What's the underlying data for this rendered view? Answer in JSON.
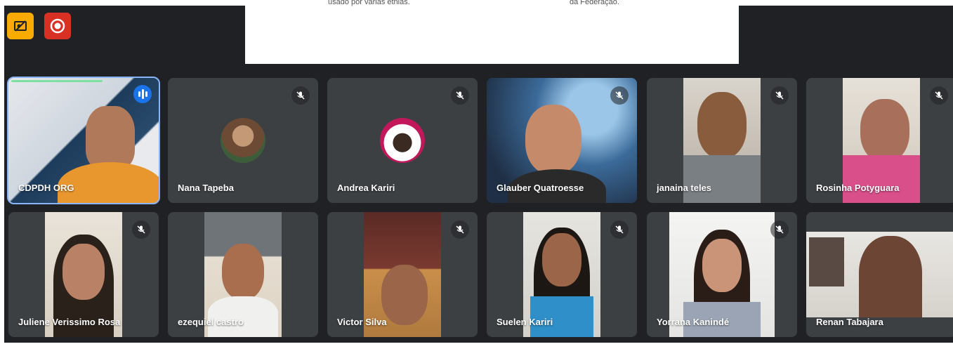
{
  "shared_screen": {
    "text_left": "usado por várias etnias.",
    "text_right": "da Federação."
  },
  "toolbar": {
    "hide_icon": "hide-self-view-icon",
    "record_icon": "recording-icon"
  },
  "colors": {
    "background": "#202124",
    "tile": "#3c4043",
    "active_outline": "#8ab4f8",
    "hide_button": "#f9ab00",
    "record_button": "#d93025",
    "speaking": "#1a73e8"
  },
  "participants": [
    {
      "name": "CDPDH ORG",
      "state": "speaking",
      "view": "camera"
    },
    {
      "name": "Nana Tapeba",
      "state": "muted",
      "view": "avatar"
    },
    {
      "name": "Andrea Kariri",
      "state": "muted",
      "view": "avatar"
    },
    {
      "name": "Glauber Quatroesse",
      "state": "muted",
      "view": "camera"
    },
    {
      "name": "janaina teles",
      "state": "muted",
      "view": "camera"
    },
    {
      "name": "Rosinha Potyguara",
      "state": "muted",
      "view": "camera"
    },
    {
      "name": "Juliene Verissimo Rosa",
      "state": "muted",
      "view": "camera"
    },
    {
      "name": "ezequiel castro",
      "state": "muted",
      "view": "camera"
    },
    {
      "name": "Victor Silva",
      "state": "muted",
      "view": "camera"
    },
    {
      "name": "Suelen Kariri",
      "state": "muted",
      "view": "camera"
    },
    {
      "name": "Yorrana Kanindé",
      "state": "muted",
      "view": "camera"
    },
    {
      "name": "Renan Tabajara",
      "state": "unmuted",
      "view": "camera"
    }
  ]
}
